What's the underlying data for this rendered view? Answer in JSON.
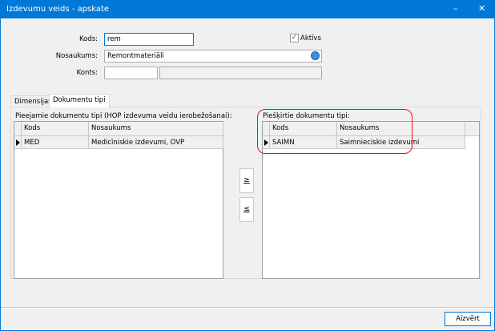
{
  "window": {
    "title": "Izdevumu veids - apskate",
    "minimize_icon": "–",
    "close_icon": "✕"
  },
  "form": {
    "kods_label": "Kods:",
    "kods_value": "rem",
    "aktivs_label": "Aktīvs",
    "aktivs_checked": true,
    "check_glyph": "✓",
    "nosaukums_label": "Nosaukums:",
    "nosaukums_value": "Remontmateriāli",
    "konts_label": "Konts:",
    "konts_value": "",
    "konts_name": ""
  },
  "tabs": [
    {
      "label": "Dimensijas"
    },
    {
      "label": "Dokumentu tipi",
      "active": true
    }
  ],
  "available": {
    "title": "Pieejamie dokumentu tipi (HOP izdevuma veidu ierobežošanai):",
    "columns": [
      "Kods",
      "Nosaukums"
    ],
    "rows": [
      {
        "kods": "MED",
        "nosaukums": "Medicīniskie izdevumi, OVP"
      }
    ]
  },
  "assigned": {
    "title": "Piešķirtie dokumentu tipi:",
    "columns": [
      "Kods",
      "Nosaukums"
    ],
    "rows": [
      {
        "kods": "SAIMN",
        "nosaukums": "Saimnieciskie izdevumi"
      }
    ]
  },
  "buttons": {
    "add": "≥",
    "remove": "≤",
    "close": "Aizvērt"
  },
  "highlight_color": "#e8101a"
}
